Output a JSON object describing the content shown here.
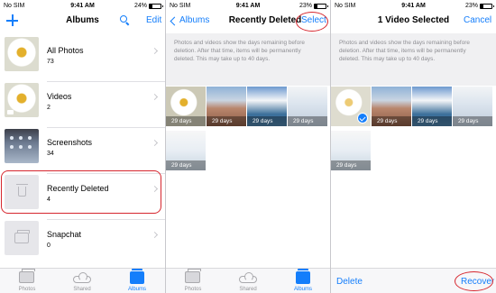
{
  "colors": {
    "accent": "#147efb",
    "highlight": "#d6262e",
    "muted": "#8e8e93"
  },
  "status": {
    "carrier": "No SIM",
    "carrier_icon": "wifi-icon",
    "time": "9:41 AM",
    "battery": "24%",
    "battery3": "23%"
  },
  "screen1": {
    "title": "Albums",
    "edit": "Edit",
    "albums": [
      {
        "name": "All Photos",
        "count": "73",
        "thumb": "flower-photo"
      },
      {
        "name": "Videos",
        "count": "2",
        "thumb": "flower-video"
      },
      {
        "name": "Screenshots",
        "count": "34",
        "thumb": "phone-screenshot"
      },
      {
        "name": "Recently Deleted",
        "count": "4",
        "thumb": "trash-icon",
        "highlighted": true
      },
      {
        "name": "Snapchat",
        "count": "0",
        "thumb": "snapchat-folder-icon"
      }
    ]
  },
  "tabbar": {
    "tabs": [
      {
        "label": "Photos",
        "icon": "photos-icon"
      },
      {
        "label": "Shared",
        "icon": "cloud-icon"
      },
      {
        "label": "Albums",
        "icon": "albums-icon",
        "active": true
      }
    ]
  },
  "screen2": {
    "back": "Albums",
    "title": "Recently Deleted",
    "select": "Select",
    "info": "Photos and videos show the days remaining before deletion. After that time, items will be permanently deleted. This may take up to 40 days.",
    "items": [
      {
        "days": "29 days"
      },
      {
        "days": "29 days"
      },
      {
        "days": "29 days"
      },
      {
        "days": "29 days"
      },
      {
        "days": "29 days"
      }
    ]
  },
  "screen3": {
    "title": "1 Video Selected",
    "cancel": "Cancel",
    "info": "Photos and videos show the days remaining before deletion. After that time, items will be permanently deleted. This may take up to 40 days.",
    "items": [
      {
        "days": "",
        "selected": true
      },
      {
        "days": "29 days"
      },
      {
        "days": "29 days"
      },
      {
        "days": "29 days"
      },
      {
        "days": "29 days"
      }
    ],
    "delete": "Delete",
    "recover": "Recover"
  }
}
